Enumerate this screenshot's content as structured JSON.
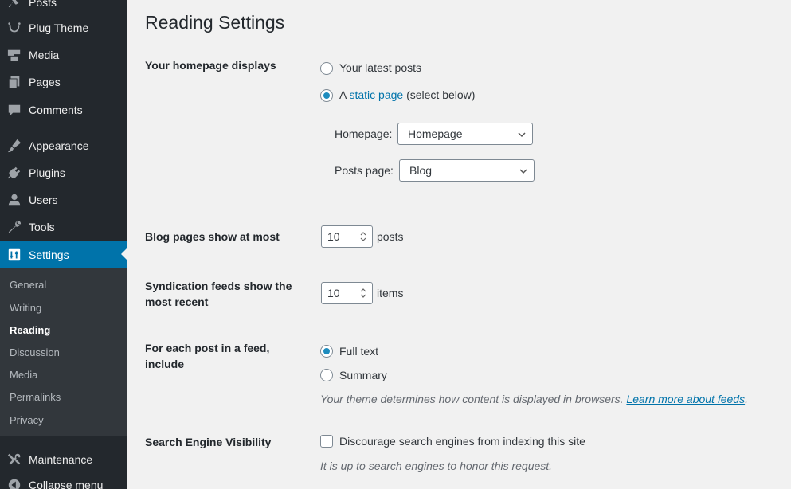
{
  "sidebar": {
    "items": [
      {
        "label": "Posts",
        "icon": "pin-icon"
      },
      {
        "label": "Plug Theme",
        "icon": "smile-icon"
      },
      {
        "label": "Media",
        "icon": "media-icon"
      },
      {
        "label": "Pages",
        "icon": "pages-icon"
      },
      {
        "label": "Comments",
        "icon": "comments-icon"
      },
      {
        "label": "Appearance",
        "icon": "brush-icon"
      },
      {
        "label": "Plugins",
        "icon": "plug-icon"
      },
      {
        "label": "Users",
        "icon": "user-icon"
      },
      {
        "label": "Tools",
        "icon": "wrench-icon"
      },
      {
        "label": "Settings",
        "icon": "settings-icon"
      },
      {
        "label": "Maintenance",
        "icon": "tools-icon"
      },
      {
        "label": "Collapse menu",
        "icon": "collapse-icon"
      }
    ],
    "submenu": [
      "General",
      "Writing",
      "Reading",
      "Discussion",
      "Media",
      "Permalinks",
      "Privacy"
    ],
    "current_sub": "Reading"
  },
  "page": {
    "title": "Reading Settings",
    "homepage_displays": {
      "label": "Your homepage displays",
      "opt_latest": "Your latest posts",
      "opt_static_prefix": "A",
      "opt_static_link": "static page",
      "opt_static_suffix": "(select below)",
      "selected": "static",
      "homepage_label": "Homepage:",
      "homepage_value": "Homepage",
      "posts_page_label": "Posts page:",
      "posts_page_value": "Blog"
    },
    "blog_pages": {
      "label": "Blog pages show at most",
      "value": "10",
      "unit": "posts"
    },
    "syndication": {
      "label": "Syndication feeds show the most recent",
      "value": "10",
      "unit": "items"
    },
    "feed_include": {
      "label": "For each post in a feed, include",
      "opt_full": "Full text",
      "opt_summary": "Summary",
      "selected": "full",
      "desc_prefix": "Your theme determines how content is displayed in browsers.",
      "desc_link": "Learn more about feeds",
      "desc_suffix": "."
    },
    "search_visibility": {
      "label": "Search Engine Visibility",
      "checkbox_label": "Discourage search engines from indexing this site",
      "checked": false,
      "desc": "It is up to search engines to honor this request."
    }
  },
  "colors": {
    "sidebar_bg": "#23282d",
    "accent": "#0073aa",
    "page_bg": "#f1f1f1"
  }
}
